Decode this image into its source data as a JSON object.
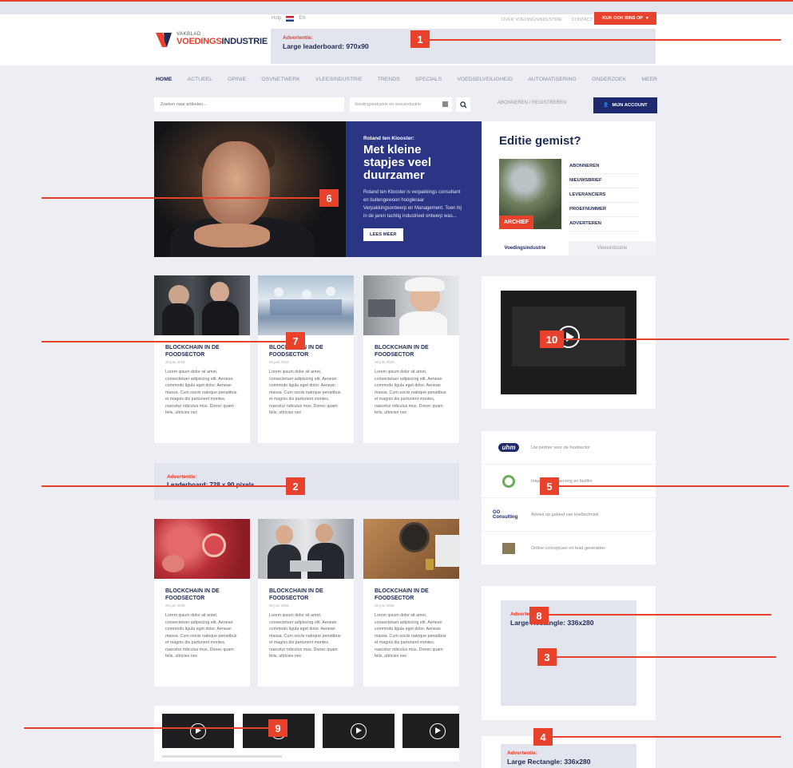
{
  "topbar": {
    "lang_nl": "Hulp",
    "lang_en": "EN",
    "links": [
      "OVER VOEDINGSINDUSTRIE",
      "CONTACT"
    ],
    "cta": "KIJK OOK BINS OP"
  },
  "header": {
    "logo_small": "VAKBLAD",
    "logo_big_a": "VOEDINGS",
    "logo_big_b": "INDUSTRIE",
    "ad_label": "Advertentie:",
    "ad_size": "Large leaderboard: 970x90"
  },
  "nav": {
    "items": [
      "HOME",
      "ACTUEEL",
      "OPINIE",
      "OSVnetwerk",
      "VLEESINDUSTRIE",
      "TRENDS",
      "SPECIALS",
      "VOEDSELVEILIGHEID",
      "AUTOMATISERING",
      "ONDERZOEK",
      "MEER"
    ]
  },
  "search": {
    "placeholder": "Zoeken naar artikelen...",
    "scope": "Voedingsindustrie en vleesindustrie",
    "subscribe": "ABONNEREN / REGISTREREN",
    "account": "MIJN ACCOUNT"
  },
  "hero": {
    "kicker": "Roland ten Klooster:",
    "title": "Met kleine stapjes veel duurzamer",
    "body": "Roland ten Klooster is verpakkings consultant en buitengewoon hoogleraar Verpakkingsontwerp en Management. Toen hij in de jaren tachtig industrieel ontwerp was...",
    "button": "LEES MEER"
  },
  "edition": {
    "title": "Editie gemist?",
    "cover_label": "ARCHIEF",
    "links": [
      "ABONNEREN",
      "NIEUWSBRIEF",
      "LEVERANCIERS",
      "PROEFNUMMER",
      "ADVERTEREN"
    ],
    "tabs": [
      "Voedingsindustrie",
      "Vleesindustrie"
    ]
  },
  "cards": [
    {
      "title": "BLOCKCHAIN IN DE FOODSECTOR",
      "date": "20 juni 2018",
      "body": "Lorem ipsum dolor sit amet, consectetuer adipiscing elit. Aenean commodo ligula eget dolor. Aenean massa. Cum sociis natoque penatibus et magnis dis parturient montes, nascetur ridiculus mus. Donec quam felis, ultricies nec"
    },
    {
      "title": "BLOCKCHAIN IN DE FOODSECTOR",
      "date": "20 juni 2018",
      "body": "Lorem ipsum dolor sit amet, consectetuer adipiscing elit. Aenean commodo ligula eget dolor. Aenean massa. Cum sociis natoque penatibus et magnis dis parturient montes, nascetur ridiculus mus. Donec quam felis, ultricies nec"
    },
    {
      "title": "BLOCKCHAIN IN DE FOODSECTOR",
      "date": "20 juni 2018",
      "body": "Lorem ipsum dolor sit amet, consectetuer adipiscing elit. Aenean commodo ligula eget dolor. Aenean massa. Cum sociis natoque penatibus et magnis dis parturient montes, nascetur ridiculus mus. Donec quam felis, ultricies nec"
    },
    {
      "title": "BLOCKCHAIN IN DE FOODSECTOR",
      "date": "20 juni 2018",
      "body": "Lorem ipsum dolor sit amet, consectetuer adipiscing elit. Aenean commodo ligula eget dolor. Aenean massa. Cum sociis natoque penatibus et magnis dis parturient montes, nascetur ridiculus mus. Donec quam felis, ultricies nec"
    },
    {
      "title": "BLOCKCHAIN IN DE FOODSECTOR",
      "date": "20 juni 2018",
      "body": "Lorem ipsum dolor sit amet, consectetuer adipiscing elit. Aenean commodo ligula eget dolor. Aenean massa. Cum sociis natoque penatibus et magnis dis parturient montes, nascetur ridiculus mus. Donec quam felis, ultricies nec"
    },
    {
      "title": "BLOCKCHAIN IN DE FOODSECTOR",
      "date": "20 juni 2018",
      "body": "Lorem ipsum dolor sit amet, consectetuer adipiscing elit. Aenean commodo ligula eget dolor. Aenean massa. Cum sociis natoque penatibus et magnis dis parturient montes, nascetur ridiculus mus. Donec quam felis, ultricies nec"
    }
  ],
  "ad_mid": {
    "label": "Advertentie:",
    "size": "Leaderboard: 728 x 90 pixels"
  },
  "partners": [
    {
      "logo": "uhm",
      "text": "Uw partner voor de foodsector"
    },
    {
      "logo": "circle",
      "text": "Inspectie, verwerving en bioﬁlm"
    },
    {
      "logo": "GO Consulting",
      "text": "Advies op gebied van koeltechniek"
    },
    {
      "logo": "square",
      "text": "Online conceptuen en lead generation"
    }
  ],
  "ad_rect": {
    "label": "Advertentie:",
    "size": "Large Rectangle: 336x280"
  },
  "ad_rect2": {
    "label": "Advertentie:",
    "size": "Large Rectangle: 336x280"
  },
  "callouts": [
    "1",
    "2",
    "3",
    "4",
    "5",
    "6",
    "7",
    "8",
    "9",
    "10"
  ],
  "colors": {
    "accent": "#e8412c",
    "navy": "#1f2a55",
    "hero_panel": "#2a3585"
  }
}
